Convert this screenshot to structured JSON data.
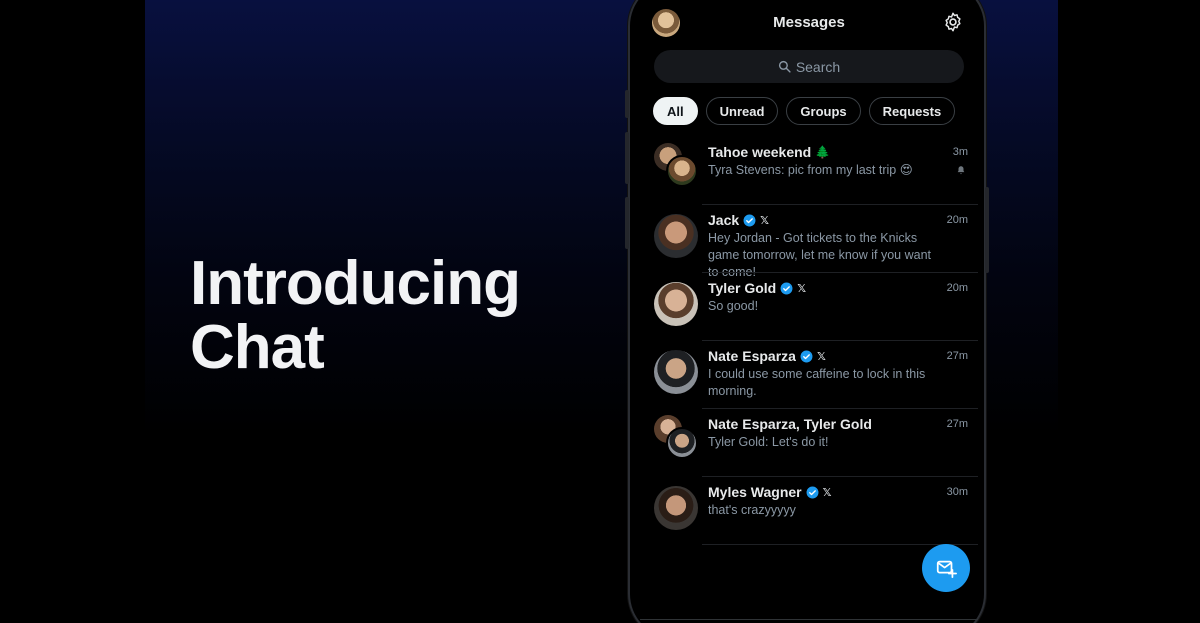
{
  "headline": {
    "line1": "Introducing",
    "line2": "Chat"
  },
  "app": {
    "title": "Messages",
    "search_placeholder": "Search",
    "filters": [
      "All",
      "Unread",
      "Groups",
      "Requests"
    ],
    "active_filter": "All"
  },
  "conversations": [
    {
      "name": "Tahoe weekend",
      "name_emoji": "🌲",
      "time": "3m",
      "message": "Tyra Stevens: pic from my last trip",
      "message_emoji": "😍",
      "group": true,
      "muted": true
    },
    {
      "name": "Jack",
      "verified": true,
      "x_badge": "𝕏",
      "time": "20m",
      "message": "Hey Jordan - Got tickets to the Knicks game tomorrow, let me know if you want to come!"
    },
    {
      "name": "Tyler Gold",
      "verified": true,
      "x_badge": "𝕏",
      "time": "20m",
      "message": "So good!"
    },
    {
      "name": "Nate Esparza",
      "verified": true,
      "x_badge": "𝕏",
      "time": "27m",
      "message": "I could use some caffeine to lock in this morning."
    },
    {
      "name": "Nate Esparza, Tyler Gold",
      "time": "27m",
      "message": "Tyler Gold: Let's do it!",
      "group": true
    },
    {
      "name": "Myles Wagner",
      "verified": true,
      "x_badge": "𝕏",
      "time": "30m",
      "message": "that's crazyyyyy"
    }
  ],
  "colors": {
    "accent": "#1d9bf0",
    "background": "#000000",
    "secondary_text": "#8b98a5"
  },
  "icons": {
    "settings": "gear-icon",
    "search": "search-icon",
    "compose": "new-message-icon",
    "verified": "verified-badge-icon",
    "mute": "mute-icon"
  }
}
